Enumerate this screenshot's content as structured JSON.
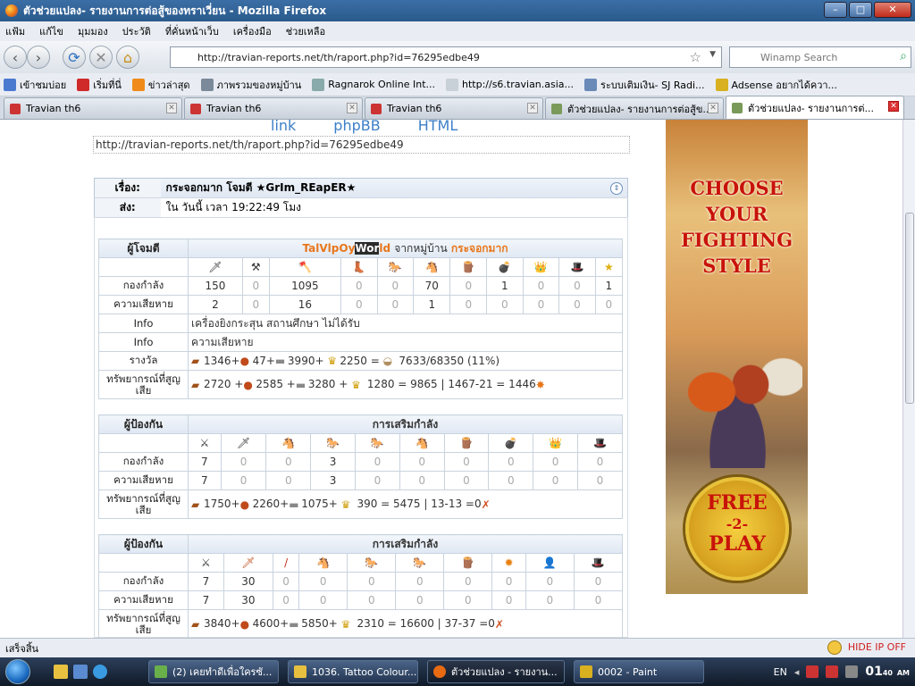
{
  "window": {
    "title": "ตัวช่วยแปลง- รายงานการต่อสู้ของทราเวี่ยน - Mozilla Firefox"
  },
  "menu": [
    "แฟ้ม",
    "แก้ไข",
    "มุมมอง",
    "ประวัติ",
    "ที่คั่นหน้าเว็บ",
    "เครื่องมือ",
    "ช่วยเหลือ"
  ],
  "nav": {
    "url": "http://travian-reports.net/th/raport.php?id=76295edbe49",
    "search_placeholder": "Winamp Search"
  },
  "bookmarks": [
    "เข้าชมบ่อย",
    "เริ่มที่นี่",
    "ข่าวล่าสุด",
    "ภาพรวมของหมู่บ้าน",
    "Ragnarok Online Int...",
    "http://s6.travian.asia...",
    "ระบบเติมเงิน- SJ Radi...",
    "Adsense อยากได้ควา..."
  ],
  "tabs": [
    "Travian th6",
    "Travian th6",
    "Travian th6",
    "ตัวช่วยแปลง- รายงานการต่อสู้ข...",
    "ตัวช่วยแปลง- รายงานการต่..."
  ],
  "page": {
    "links": [
      "link",
      "phpBB",
      "HTML"
    ],
    "report_url": "http://travian-reports.net/th/raport.php?id=76295edbe49",
    "subject_label": "เรื่อง:",
    "subject_value": "กระจอกมาก โจมตี ★GrIm_REapER★",
    "sent_label": "ส่ง:",
    "sent_value": "ใน วันนี้ เวลา 19:22:49 โมง",
    "attacker": {
      "role": "ผู้โจมตี",
      "name_pre": "TalVlpOy",
      "name_sel": "Wor",
      "name_post": "ld",
      "from": "จากหมู่บ้าน",
      "village": "กระจอกมาก",
      "troops_label": "กองกำลัง",
      "troops": [
        "150",
        "0",
        "1095",
        "0",
        "0",
        "70",
        "0",
        "1",
        "0",
        "0",
        "1"
      ],
      "loss_label": "ความเสียหาย",
      "losses": [
        "2",
        "0",
        "16",
        "0",
        "0",
        "1",
        "0",
        "0",
        "0",
        "0",
        "0"
      ],
      "info_label1": "Info",
      "info1": "เครื่องยิงกระสุน สถานศึกษา ไม่ได้รับ",
      "info_label2": "Info",
      "info2": "ความเสียหาย",
      "bounty_label": "รางวัล",
      "bounty": [
        "1346+",
        "47+",
        "3990+",
        "2250 =",
        "7633/68350 (11%)"
      ],
      "lost_label": "ทรัพยากรณ์ที่สูญเสีย",
      "lost": [
        "2720 +",
        "2585 +",
        "3280 +",
        "1280 = 9865 | 1467-21 = 1446"
      ]
    },
    "defender1": {
      "role": "ผู้ป้องกัน",
      "title": "การเสริมกำลัง",
      "troops_label": "กองกำลัง",
      "troops": [
        "7",
        "0",
        "0",
        "3",
        "0",
        "0",
        "0",
        "0",
        "0",
        "0"
      ],
      "loss_label": "ความเสียหาย",
      "losses": [
        "7",
        "0",
        "0",
        "3",
        "0",
        "0",
        "0",
        "0",
        "0",
        "0"
      ],
      "lost_label": "ทรัพยากรณ์ที่สูญเสีย",
      "lost": [
        "1750+",
        "2260+",
        "1075+",
        "390 = 5475 | 13-13 =0"
      ]
    },
    "defender2": {
      "role": "ผู้ป้องกัน",
      "title": "การเสริมกำลัง",
      "troops_label": "กองกำลัง",
      "troops": [
        "7",
        "30",
        "0",
        "0",
        "0",
        "0",
        "0",
        "0",
        "0",
        "0"
      ],
      "loss_label": "ความเสียหาย",
      "losses": [
        "7",
        "30",
        "0",
        "0",
        "0",
        "0",
        "0",
        "0",
        "0",
        "0"
      ],
      "lost_label": "ทรัพยากรณ์ที่สูญเสีย",
      "lost": [
        "3840+",
        "4600+",
        "5850+",
        "2310 = 16600 | 37-37 =0"
      ]
    }
  },
  "ad": {
    "line1": "CHOOSE",
    "line2": "YOUR",
    "line3": "FIGHTING",
    "line4": "STYLE",
    "play1": "FREE",
    "play2": "-2-",
    "play3": "PLAY"
  },
  "status": {
    "text": "เสร็จสิ้น",
    "right": "HIDE IP OFF"
  },
  "taskbar": {
    "items": [
      "(2) เคยทำดีเพื่อใครซั...",
      "1036. Tattoo Colour...",
      "ตัวช่วยแปลง - รายงาน...",
      "0002 - Paint"
    ],
    "lang": "EN",
    "time": "01",
    "time_min": "40",
    "ampm": "AM"
  },
  "colors": {
    "accent_orange": "#e8761a",
    "accent_green": "#27a02a",
    "link_blue": "#3c7fc8"
  }
}
